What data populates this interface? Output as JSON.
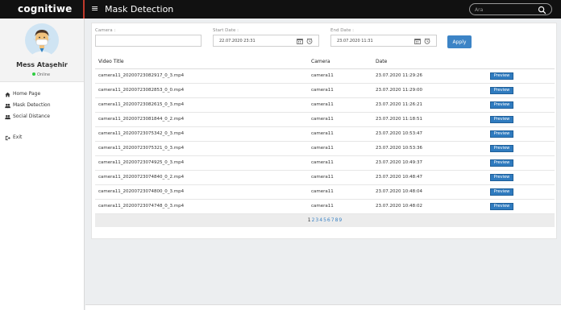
{
  "app": {
    "brand": "cognitiwe",
    "page_title": "Mask Detection"
  },
  "search": {
    "placeholder": "Ara"
  },
  "user": {
    "name": "Mess Ataşehir",
    "status": "Online"
  },
  "sidebar": {
    "items": [
      {
        "label": "Home Page",
        "icon": "home-icon"
      },
      {
        "label": "Mask Detection",
        "icon": "users-icon"
      },
      {
        "label": "Social Distance",
        "icon": "users-icon"
      },
      {
        "label": "Exit",
        "icon": "exit-icon"
      }
    ]
  },
  "filters": {
    "camera_label": "Camera :",
    "camera_value": "",
    "start_label": "Start Date :",
    "start_value": "22.07.2020 23:31",
    "end_label": "End Date :",
    "end_value": "23.07.2020 11:31",
    "apply_label": "Apply"
  },
  "table": {
    "headers": [
      "Video Title",
      "Camera",
      "Date",
      ""
    ],
    "preview_label": "Preview",
    "rows": [
      {
        "title": "camera11_20200723082917_0_3.mp4",
        "camera": "camera11",
        "date": "23.07.2020 11:29:26"
      },
      {
        "title": "camera11_20200723082853_0_0.mp4",
        "camera": "camera11",
        "date": "23.07.2020 11:29:00"
      },
      {
        "title": "camera11_20200723082615_0_3.mp4",
        "camera": "camera11",
        "date": "23.07.2020 11:26:21"
      },
      {
        "title": "camera11_20200723081844_0_2.mp4",
        "camera": "camera11",
        "date": "23.07.2020 11:18:51"
      },
      {
        "title": "camera11_20200723075342_0_3.mp4",
        "camera": "camera11",
        "date": "23.07.2020 10:53:47"
      },
      {
        "title": "camera11_20200723075321_0_3.mp4",
        "camera": "camera11",
        "date": "23.07.2020 10:53:36"
      },
      {
        "title": "camera11_20200723074925_0_3.mp4",
        "camera": "camera11",
        "date": "23.07.2020 10:49:37"
      },
      {
        "title": "camera11_20200723074840_0_2.mp4",
        "camera": "camera11",
        "date": "23.07.2020 10:48:47"
      },
      {
        "title": "camera11_20200723074800_0_3.mp4",
        "camera": "camera11",
        "date": "23.07.2020 10:48:04"
      },
      {
        "title": "camera11_20200723074748_0_3.mp4",
        "camera": "camera11",
        "date": "23.07.2020 10:48:02"
      }
    ]
  },
  "pagination": {
    "pages": [
      "1",
      "2",
      "3",
      "4",
      "5",
      "6",
      "7",
      "8",
      "9"
    ],
    "current": "1"
  },
  "colors": {
    "accent": "#3c84c6",
    "topbar": "#111111",
    "brand_divider": "#c0392b",
    "online": "#2ecc40"
  }
}
